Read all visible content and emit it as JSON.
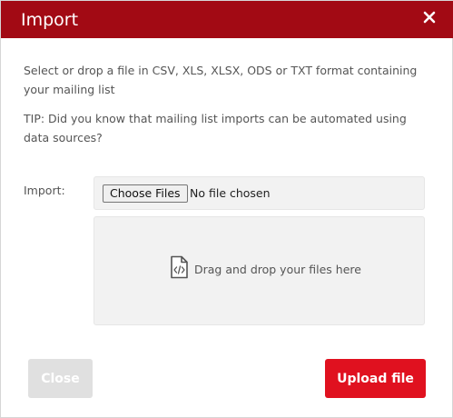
{
  "dialog": {
    "title": "Import",
    "close_icon": "close-icon",
    "header_color": "#a20a14"
  },
  "body": {
    "intro": "Select or drop a file in CSV, XLS, XLSX, ODS or TXT format containing your mailing list",
    "tip": "TIP: Did you know that mailing list imports can be automated using data sources?"
  },
  "import_field": {
    "label": "Import:",
    "choose_button": "Choose Files",
    "status": "No file chosen"
  },
  "drop_zone": {
    "icon": "code-file-icon",
    "text": "Drag and drop your files here"
  },
  "footer": {
    "close_label": "Close",
    "upload_label": "Upload file",
    "upload_color": "#e0111f"
  }
}
